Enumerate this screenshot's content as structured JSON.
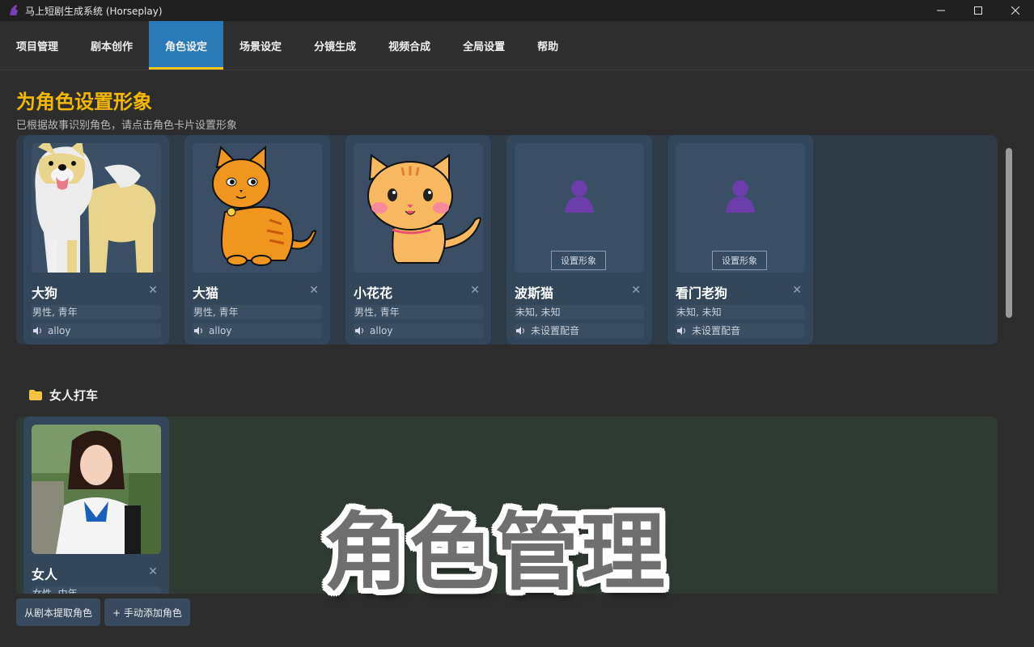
{
  "window": {
    "title": "马上短剧生成系统 (Horseplay)",
    "minimize": "minimize-icon",
    "maximize": "maximize-icon",
    "close": "close-icon"
  },
  "nav": {
    "tabs": [
      "项目管理",
      "剧本创作",
      "角色设定",
      "场景设定",
      "分镜生成",
      "视频合成",
      "全局设置",
      "帮助"
    ],
    "active": "角色设定"
  },
  "header": {
    "title": "为角色设置形象",
    "subtitle": "已根据故事识别角色，请点击角色卡片设置形象"
  },
  "characters": [
    {
      "name": "大狗",
      "meta": "男性, 青年",
      "voice": "alloy",
      "image": "dog"
    },
    {
      "name": "大猫",
      "meta": "男性, 青年",
      "voice": "alloy",
      "image": "cat"
    },
    {
      "name": "小花花",
      "meta": "男性, 青年",
      "voice": "alloy",
      "image": "kitten"
    },
    {
      "name": "波斯猫",
      "meta": "未知, 未知",
      "voice": "未设置配音",
      "image": "none",
      "set_label": "设置形象"
    },
    {
      "name": "看门老狗",
      "meta": "未知, 未知",
      "voice": "未设置配音",
      "image": "none",
      "set_label": "设置形象"
    }
  ],
  "group": {
    "title": "女人打车",
    "characters": [
      {
        "name": "女人",
        "meta": "女性, 中年",
        "image": "photo"
      }
    ]
  },
  "actions": {
    "extract": "从剧本提取角色",
    "add": "+ 手动添加角色"
  },
  "overlay_text": "角色管理",
  "colors": {
    "accent": "#2a7ab8",
    "title": "#f5b800",
    "tab_underline": "#f5c518"
  }
}
